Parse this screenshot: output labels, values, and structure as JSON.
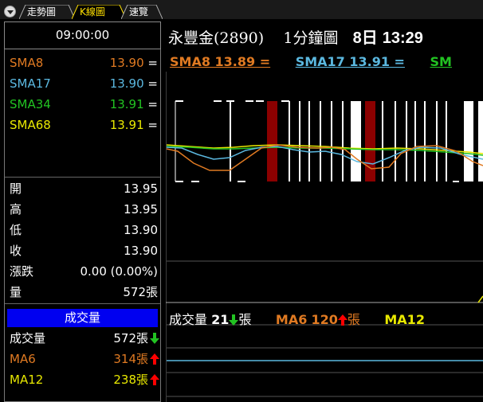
{
  "tabs": [
    {
      "label": "走勢圖",
      "active": false
    },
    {
      "label": "K線圖",
      "active": true
    },
    {
      "label": "速覽",
      "active": false
    }
  ],
  "time": "09:00:00",
  "sma_list": [
    {
      "name": "SMA8",
      "value": "13.90",
      "suffix": "=",
      "color": "#e07a22"
    },
    {
      "name": "SMA17",
      "value": "13.90",
      "suffix": "=",
      "color": "#5bb8e0"
    },
    {
      "name": "SMA34",
      "value": "13.91",
      "suffix": "=",
      "color": "#22c322"
    },
    {
      "name": "SMA68",
      "value": "13.91",
      "suffix": "=",
      "color": "#e8e800"
    }
  ],
  "ohlc": [
    {
      "label": "開",
      "value": "13.95"
    },
    {
      "label": "高",
      "value": "13.95"
    },
    {
      "label": "低",
      "value": "13.90"
    },
    {
      "label": "收",
      "value": "13.90"
    },
    {
      "label": "漲跌",
      "value": "0.00 (0.00%)"
    },
    {
      "label": "量",
      "value": "572張"
    }
  ],
  "volume_panel": {
    "header": "成交量",
    "rows": [
      {
        "label": "成交量",
        "value": "572張",
        "arrow": "down",
        "color": "#fff"
      },
      {
        "label": "MA6",
        "value": "314張",
        "arrow": "up",
        "color": "#e07a22"
      },
      {
        "label": "MA12",
        "value": "238張",
        "arrow": "up",
        "color": "#e8e800"
      }
    ]
  },
  "title": {
    "name": "永豐金(2890)",
    "period": "1分鐘圖",
    "day": "8日",
    "time": "13:29"
  },
  "chart_legend": [
    {
      "label": "SMA8 13.89 =",
      "color": "#e07a22"
    },
    {
      "label": "SMA17 13.91 =",
      "color": "#5bb8e0"
    },
    {
      "label": "SM",
      "color": "#22c322"
    }
  ],
  "volume_legend": {
    "vol_label": "成交量",
    "vol_value": "21",
    "vol_unit": "張",
    "ma6_label": "MA6",
    "ma6_value": "120",
    "ma6_unit": "張",
    "ma12_label": "MA12"
  },
  "chart_data": {
    "type": "candlestick",
    "price_lines": {
      "SMA8": [
        13.9,
        13.9,
        13.89,
        13.89,
        13.89,
        13.9,
        13.91,
        13.91,
        13.91,
        13.9,
        13.9,
        13.9,
        13.89,
        13.89,
        13.9,
        13.91,
        13.91,
        13.91
      ],
      "SMA17": [
        13.91,
        13.91,
        13.905,
        13.905,
        13.91,
        13.91,
        13.915,
        13.915,
        13.91,
        13.91,
        13.905,
        13.905,
        13.905,
        13.91,
        13.91,
        13.915,
        13.915,
        13.91
      ]
    },
    "volume_ma_level": 314
  },
  "colors": {
    "background": "#000000",
    "up_candle": "#ffffff",
    "down_candle": "#8b0000",
    "grid": "#555555",
    "volume_baseline": "#5bb8e0",
    "down_arrow": "#22c322",
    "up_arrow": "#ff0000"
  }
}
